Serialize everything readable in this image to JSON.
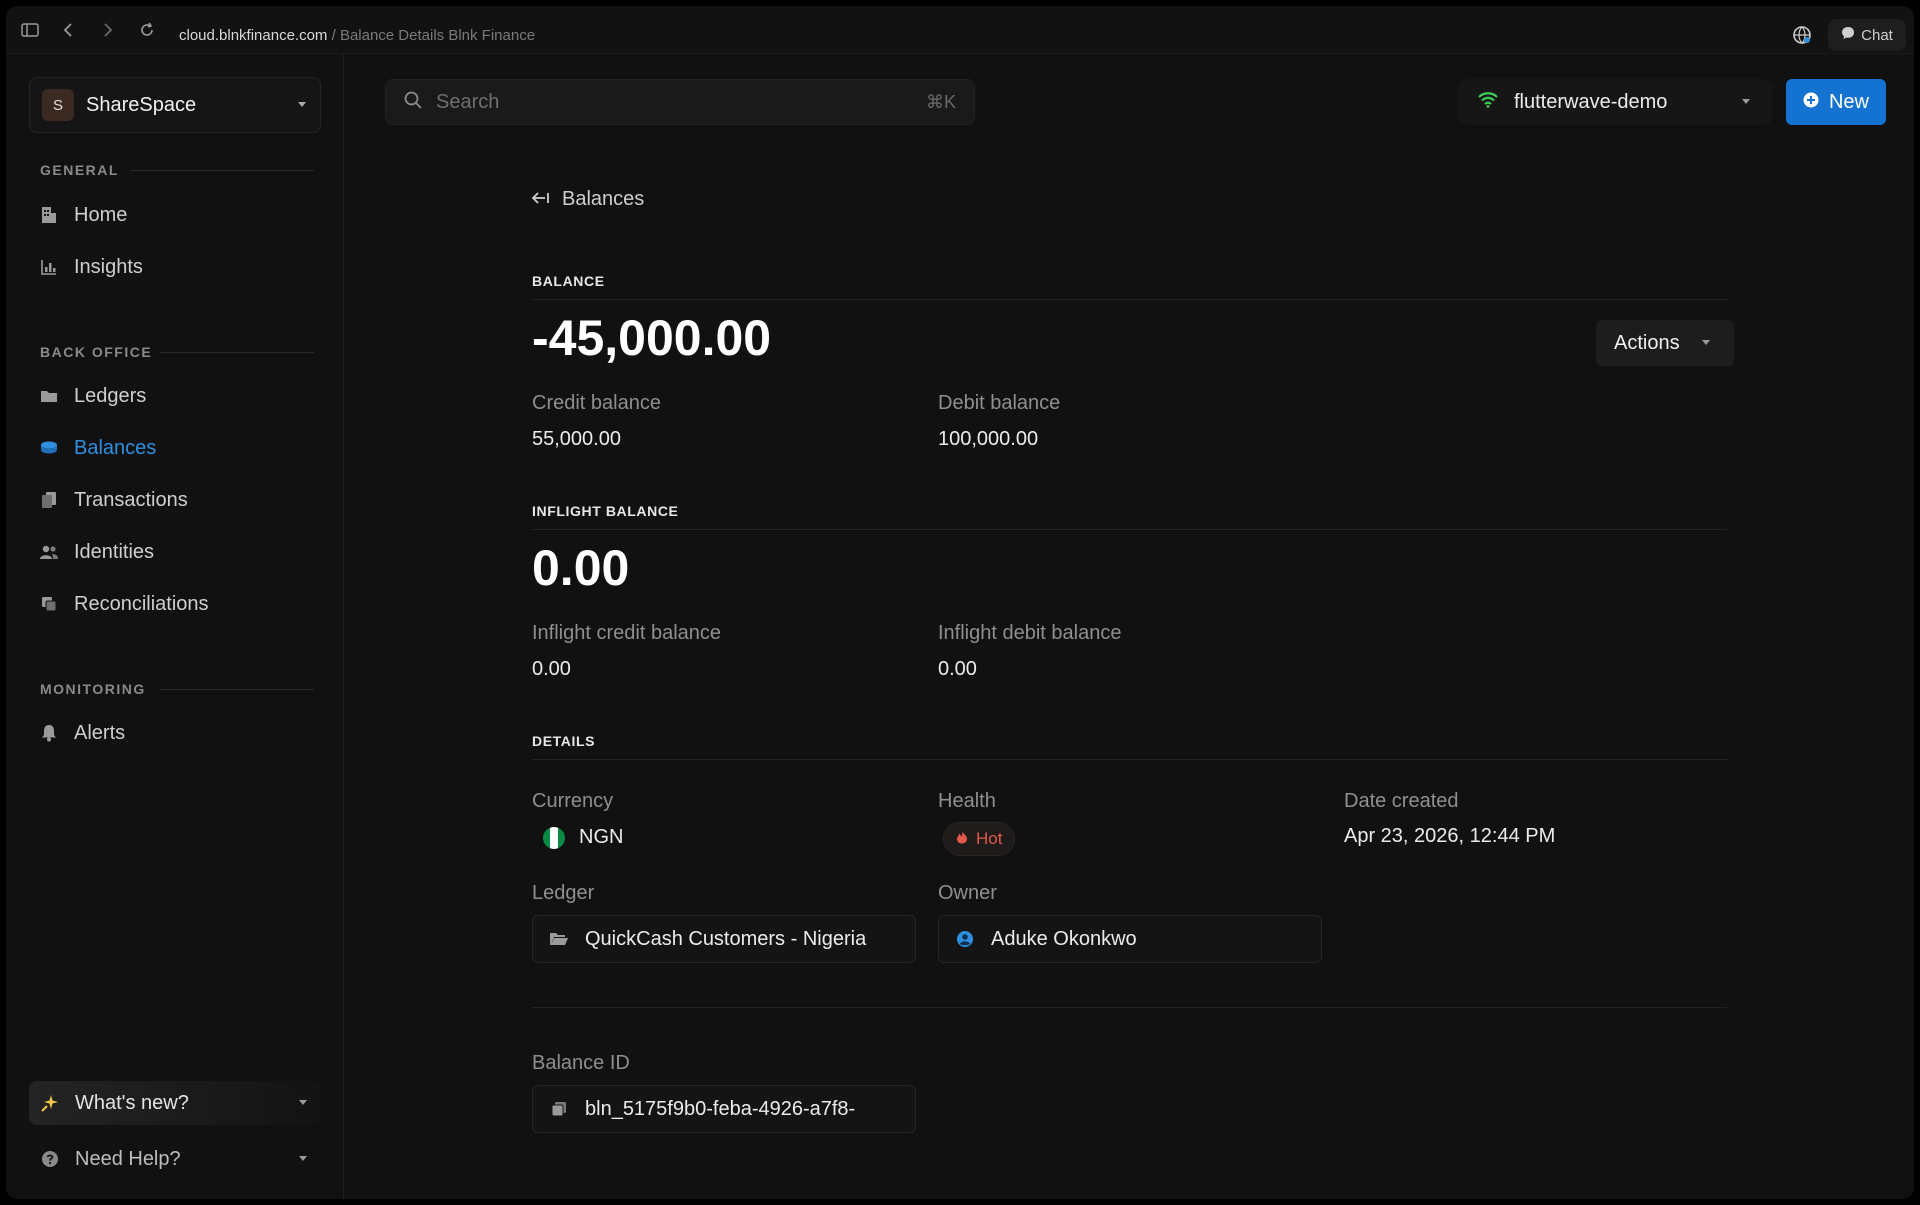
{
  "browser": {
    "url_domain": "cloud.blnkfinance.com",
    "url_separator": "/",
    "page_title": "Balance Details Blnk Finance",
    "chat_label": "Chat"
  },
  "sidebar": {
    "workspace": {
      "initial": "S",
      "name": "ShareSpace"
    },
    "sections": [
      {
        "label": "GENERAL"
      },
      {
        "label": "BACK OFFICE"
      },
      {
        "label": "MONITORING"
      }
    ],
    "items": [
      {
        "label": "Home",
        "icon": "building-icon"
      },
      {
        "label": "Insights",
        "icon": "bar-chart-icon"
      },
      {
        "label": "Ledgers",
        "icon": "folder-icon"
      },
      {
        "label": "Balances",
        "icon": "coins-icon",
        "active": true
      },
      {
        "label": "Transactions",
        "icon": "files-icon"
      },
      {
        "label": "Identities",
        "icon": "users-icon"
      },
      {
        "label": "Reconciliations",
        "icon": "copy-icon"
      },
      {
        "label": "Alerts",
        "icon": "bell-icon"
      }
    ],
    "whats_new": "What's new?",
    "need_help": "Need Help?"
  },
  "topbar": {
    "search_placeholder": "Search",
    "search_shortcut": "⌘K",
    "environment": "flutterwave-demo",
    "new_label": "New"
  },
  "main": {
    "back_label": "Balances",
    "balance": {
      "heading": "BALANCE",
      "amount": "-45,000.00",
      "actions_label": "Actions",
      "credit_label": "Credit balance",
      "credit_value": "55,000.00",
      "debit_label": "Debit balance",
      "debit_value": "100,000.00"
    },
    "inflight": {
      "heading": "INFLIGHT BALANCE",
      "amount": "0.00",
      "credit_label": "Inflight credit balance",
      "credit_value": "0.00",
      "debit_label": "Inflight debit balance",
      "debit_value": "0.00"
    },
    "details": {
      "heading": "DETAILS",
      "currency_label": "Currency",
      "currency_value": "NGN",
      "health_label": "Health",
      "health_value": "Hot",
      "date_label": "Date created",
      "date_value": "Apr 23, 2026, 12:44 PM",
      "ledger_label": "Ledger",
      "ledger_value": "QuickCash Customers - Nigeria",
      "owner_label": "Owner",
      "owner_value": "Aduke Okonkwo",
      "balance_id_label": "Balance ID",
      "balance_id_value": "bln_5175f9b0-feba-4926-a7f8-"
    }
  },
  "colors": {
    "accent": "#1473d0",
    "active_nav": "#2f8fe0",
    "hot": "#e25a4a",
    "env_signal": "#3ecf5a"
  }
}
